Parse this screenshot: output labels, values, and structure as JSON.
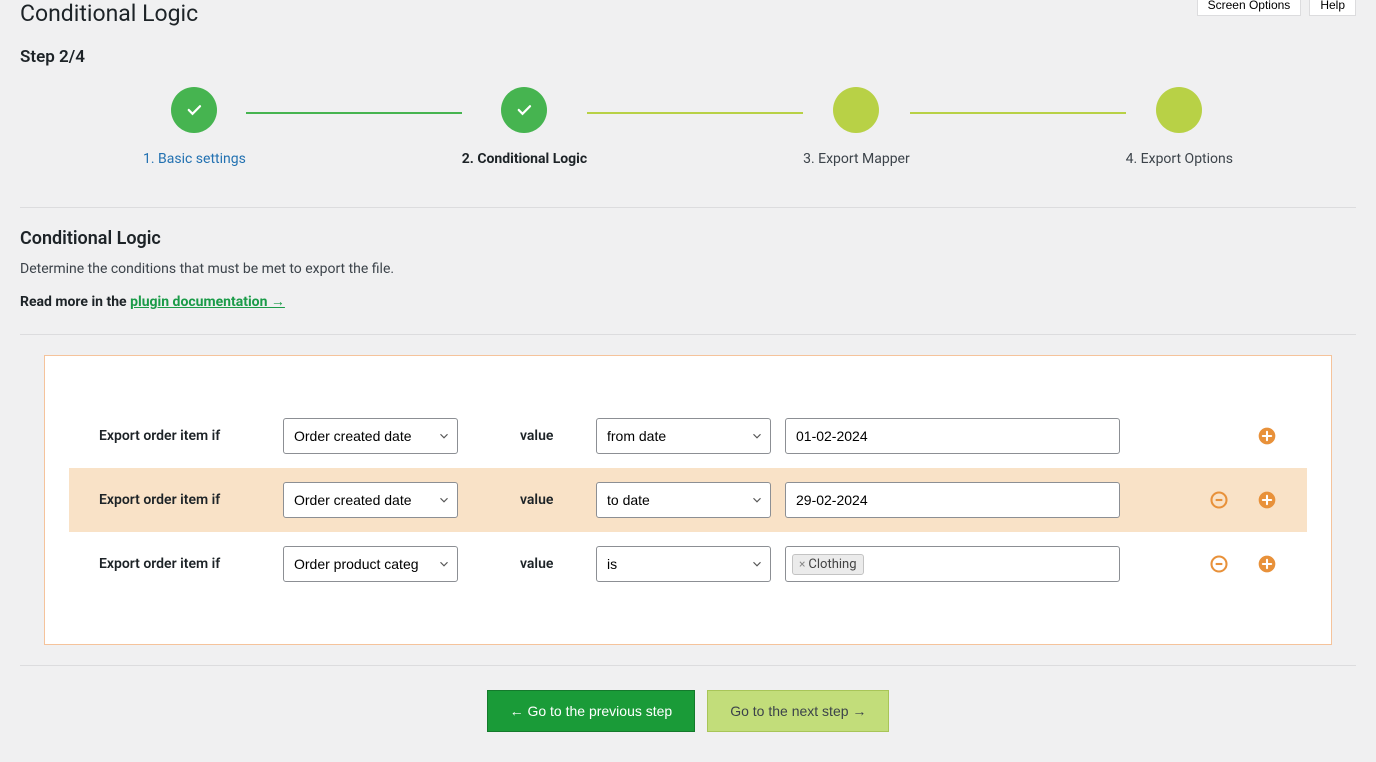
{
  "page_title": "Conditional Logic",
  "top_buttons": {
    "screen_options": "Screen Options",
    "help": "Help"
  },
  "step_indicator": "Step 2/4",
  "steps": {
    "s1": "1. Basic settings",
    "s2": "2. Conditional Logic",
    "s3": "3. Export Mapper",
    "s4": "4. Export Options"
  },
  "section": {
    "title": "Conditional Logic",
    "desc": "Determine the conditions that must be met to export the file.",
    "doc_prefix": "Read more in the ",
    "doc_link": "plugin documentation →"
  },
  "labels": {
    "row_label": "Export order item if",
    "value": "value"
  },
  "select_options": {
    "field_created": "Order created date",
    "field_category": "Order product categ",
    "op_from": "from date",
    "op_to": "to date",
    "op_is": "is"
  },
  "rows": {
    "r1": {
      "value": "01-02-2024"
    },
    "r2": {
      "value": "29-02-2024"
    },
    "r3": {
      "tag": "Clothing"
    }
  },
  "nav": {
    "prev": "← Go to the previous step",
    "next": "Go to the next step →"
  },
  "colors": {
    "orange": "#e8913a"
  }
}
